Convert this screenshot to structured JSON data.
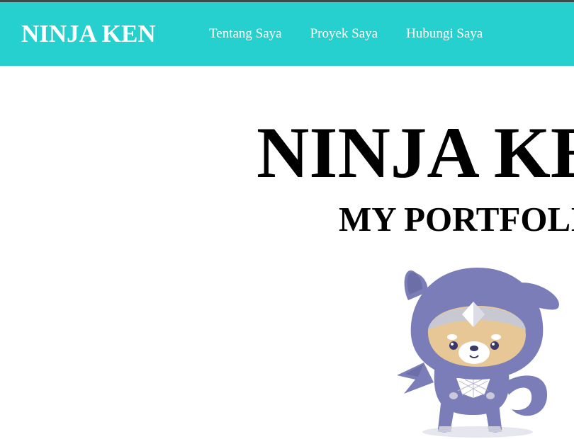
{
  "header": {
    "logo": "NINJA KEN",
    "nav": [
      {
        "label": "Tentang Saya"
      },
      {
        "label": "Proyek Saya"
      },
      {
        "label": "Hubungi Saya"
      }
    ]
  },
  "hero": {
    "title": "NINJA KEN",
    "subtitle": "MY PORTFOLIO"
  },
  "colors": {
    "header_bg": "#26d0ce",
    "header_text": "#ffffff",
    "mascot_body": "#7b7db8",
    "mascot_face": "#e8c797"
  }
}
